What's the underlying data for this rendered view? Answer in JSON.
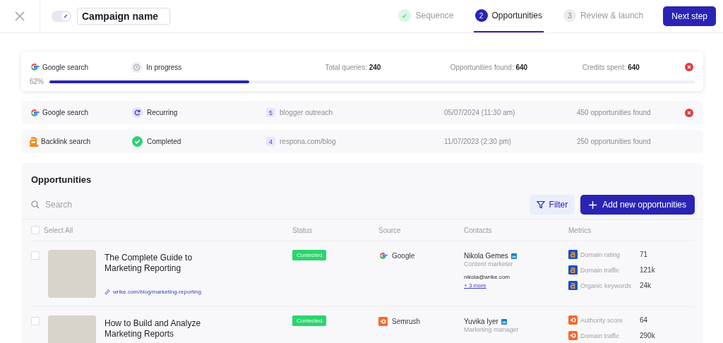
{
  "header": {
    "campaign_name": "Campaign name",
    "toggle_on": true,
    "steps": [
      {
        "marker": "✓",
        "label": "Sequence",
        "kind": "done",
        "selected": false
      },
      {
        "marker": "2",
        "label": "Opportunities",
        "kind": "current",
        "selected": true
      },
      {
        "marker": "3",
        "label": "Review & launch",
        "kind": "todo",
        "selected": false
      }
    ],
    "next_button": "Next step"
  },
  "active_search": {
    "source": {
      "kind": "google",
      "name": "Google search"
    },
    "status": {
      "kind": "in_progress",
      "label": "In progress"
    },
    "stats": [
      {
        "label": "Total queries:",
        "value": "240"
      },
      {
        "label": "Opportunities found:",
        "value": "640"
      },
      {
        "label": "Credits spent:",
        "value": "640"
      }
    ],
    "removable": true,
    "percent": "62%",
    "level": 0.31
  },
  "searches": [
    {
      "source": {
        "kind": "google",
        "name": "Google search"
      },
      "status": {
        "kind": "recurring",
        "label": "Recurring"
      },
      "count": "5",
      "query": "blogger outreach",
      "date": "05/07/2024 (11:30 am)",
      "found": "450 opportunities found",
      "removable": true
    },
    {
      "source": {
        "kind": "backlink",
        "name": "Backlink search"
      },
      "status": {
        "kind": "completed",
        "label": "Completed"
      },
      "count": "4",
      "query": "respona.com/blog",
      "date": "11/07/2023 (2:30 pm)",
      "found": "250 opportunities found",
      "removable": false
    }
  ],
  "opportunities": {
    "title": "Opportunities",
    "search": {
      "placeholder": "Search"
    },
    "filter_button": "Filter",
    "add_button": "Add new opportunities",
    "columns": [
      "Select All",
      "Status",
      "Source",
      "Contacts",
      "Metrics"
    ],
    "select_all_checked": false,
    "rows": [
      {
        "checked": false,
        "title": "The Complete Guide to Marketing Reporting",
        "url": "wrike.com/blog/marketing-reporting",
        "status": "Contected",
        "source": {
          "kind": "google",
          "name": "Google"
        },
        "contact": {
          "name": "Nikola Gemes",
          "role": "Content marketer",
          "email": "nikola@wrike.com",
          "more": "+ 3 more"
        },
        "metrics": [
          {
            "kind": "ahrefs",
            "label": "Domain rating",
            "value": "71"
          },
          {
            "kind": "ahrefs",
            "label": "Domain traffic",
            "value": "121k"
          },
          {
            "kind": "ahrefs",
            "label": "Organic keywords",
            "value": "24k"
          }
        ]
      },
      {
        "checked": false,
        "title": "How to Build and Analyze Marketing Reports",
        "status": "Contected",
        "source": {
          "kind": "semrush",
          "name": "Semrush"
        },
        "contact": {
          "name": "Yuvika Iyer",
          "role": "Marketing manager"
        },
        "metrics": [
          {
            "kind": "semrush",
            "label": "Authority score",
            "value": "64"
          },
          {
            "kind": "semrush",
            "label": "Domain traffic",
            "value": "290k"
          }
        ]
      }
    ]
  }
}
